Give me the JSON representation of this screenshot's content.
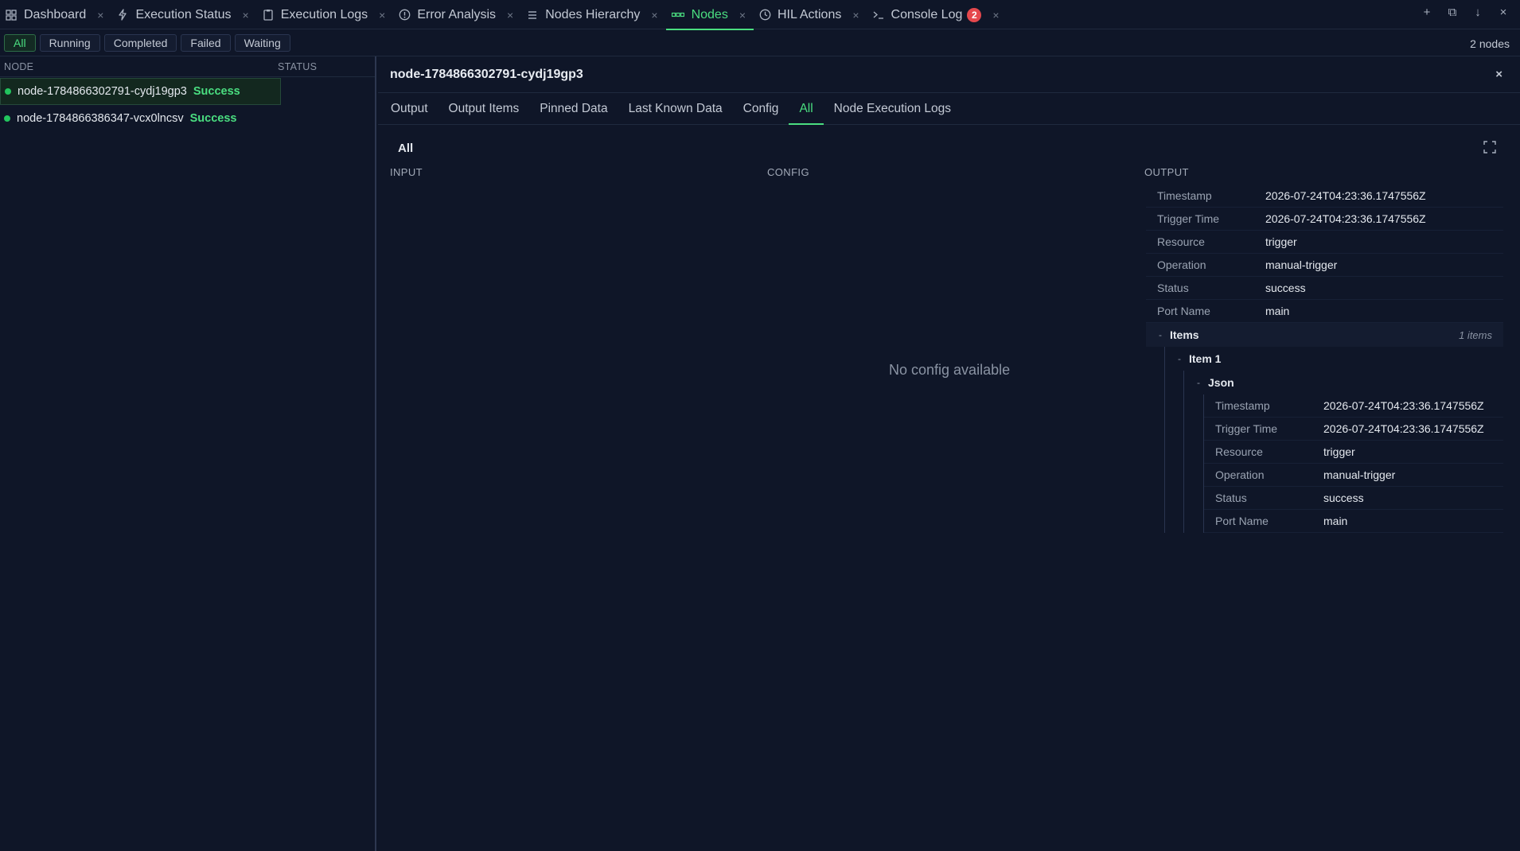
{
  "tabs": [
    {
      "label": "Dashboard",
      "icon": "grid-icon",
      "active": false
    },
    {
      "label": "Execution Status",
      "icon": "bolt-icon",
      "active": false
    },
    {
      "label": "Execution Logs",
      "icon": "clipboard-icon",
      "active": false
    },
    {
      "label": "Error Analysis",
      "icon": "alert-circle-icon",
      "active": false
    },
    {
      "label": "Nodes Hierarchy",
      "icon": "list-icon",
      "active": false
    },
    {
      "label": "Nodes",
      "icon": "nodes-icon",
      "active": true
    },
    {
      "label": "HIL Actions",
      "icon": "clock-icon",
      "active": false
    },
    {
      "label": "Console Log",
      "icon": "terminal-icon",
      "active": false,
      "badge": "2"
    }
  ],
  "window_controls": [
    "+",
    "⧉",
    "↓",
    "×"
  ],
  "filters": {
    "buttons": [
      "All",
      "Running",
      "Completed",
      "Failed",
      "Waiting"
    ],
    "active": "All",
    "count_text": "2 nodes"
  },
  "node_list": {
    "col_node": "NODE",
    "col_status": "STATUS",
    "rows": [
      {
        "name": "node-1784866302791-cydj19gp3",
        "status": "Success",
        "selected": true
      },
      {
        "name": "node-1784866386347-vcx0lncsv",
        "status": "Success",
        "selected": false
      }
    ]
  },
  "detail": {
    "title": "node-1784866302791-cydj19gp3",
    "close": "×",
    "tabs": [
      "Output",
      "Output Items",
      "Pinned Data",
      "Last Known Data",
      "Config",
      "All",
      "Node Execution Logs"
    ],
    "active_tab": "All",
    "section_label": "All",
    "col_input": "INPUT",
    "col_config": "CONFIG",
    "col_output": "OUTPUT",
    "no_config": "No config available",
    "output_fields": [
      {
        "key": "Timestamp",
        "value": "2026-07-24T04:23:36.1747556Z"
      },
      {
        "key": "Trigger Time",
        "value": "2026-07-24T04:23:36.1747556Z"
      },
      {
        "key": "Resource",
        "value": "trigger"
      },
      {
        "key": "Operation",
        "value": "manual-trigger"
      },
      {
        "key": "Status",
        "value": "success"
      },
      {
        "key": "Port Name",
        "value": "main"
      }
    ],
    "items_label": "Items",
    "items_count": "1 items",
    "item1_label": "Item 1",
    "json_label": "Json",
    "toggle": "-",
    "json_fields": [
      {
        "key": "Timestamp",
        "value": "2026-07-24T04:23:36.1747556Z"
      },
      {
        "key": "Trigger Time",
        "value": "2026-07-24T04:23:36.1747556Z"
      },
      {
        "key": "Resource",
        "value": "trigger"
      },
      {
        "key": "Operation",
        "value": "manual-trigger"
      },
      {
        "key": "Status",
        "value": "success"
      },
      {
        "key": "Port Name",
        "value": "main"
      }
    ]
  },
  "colors": {
    "accent": "#4ade80",
    "background": "#0f1628",
    "badge": "#e5484d"
  }
}
